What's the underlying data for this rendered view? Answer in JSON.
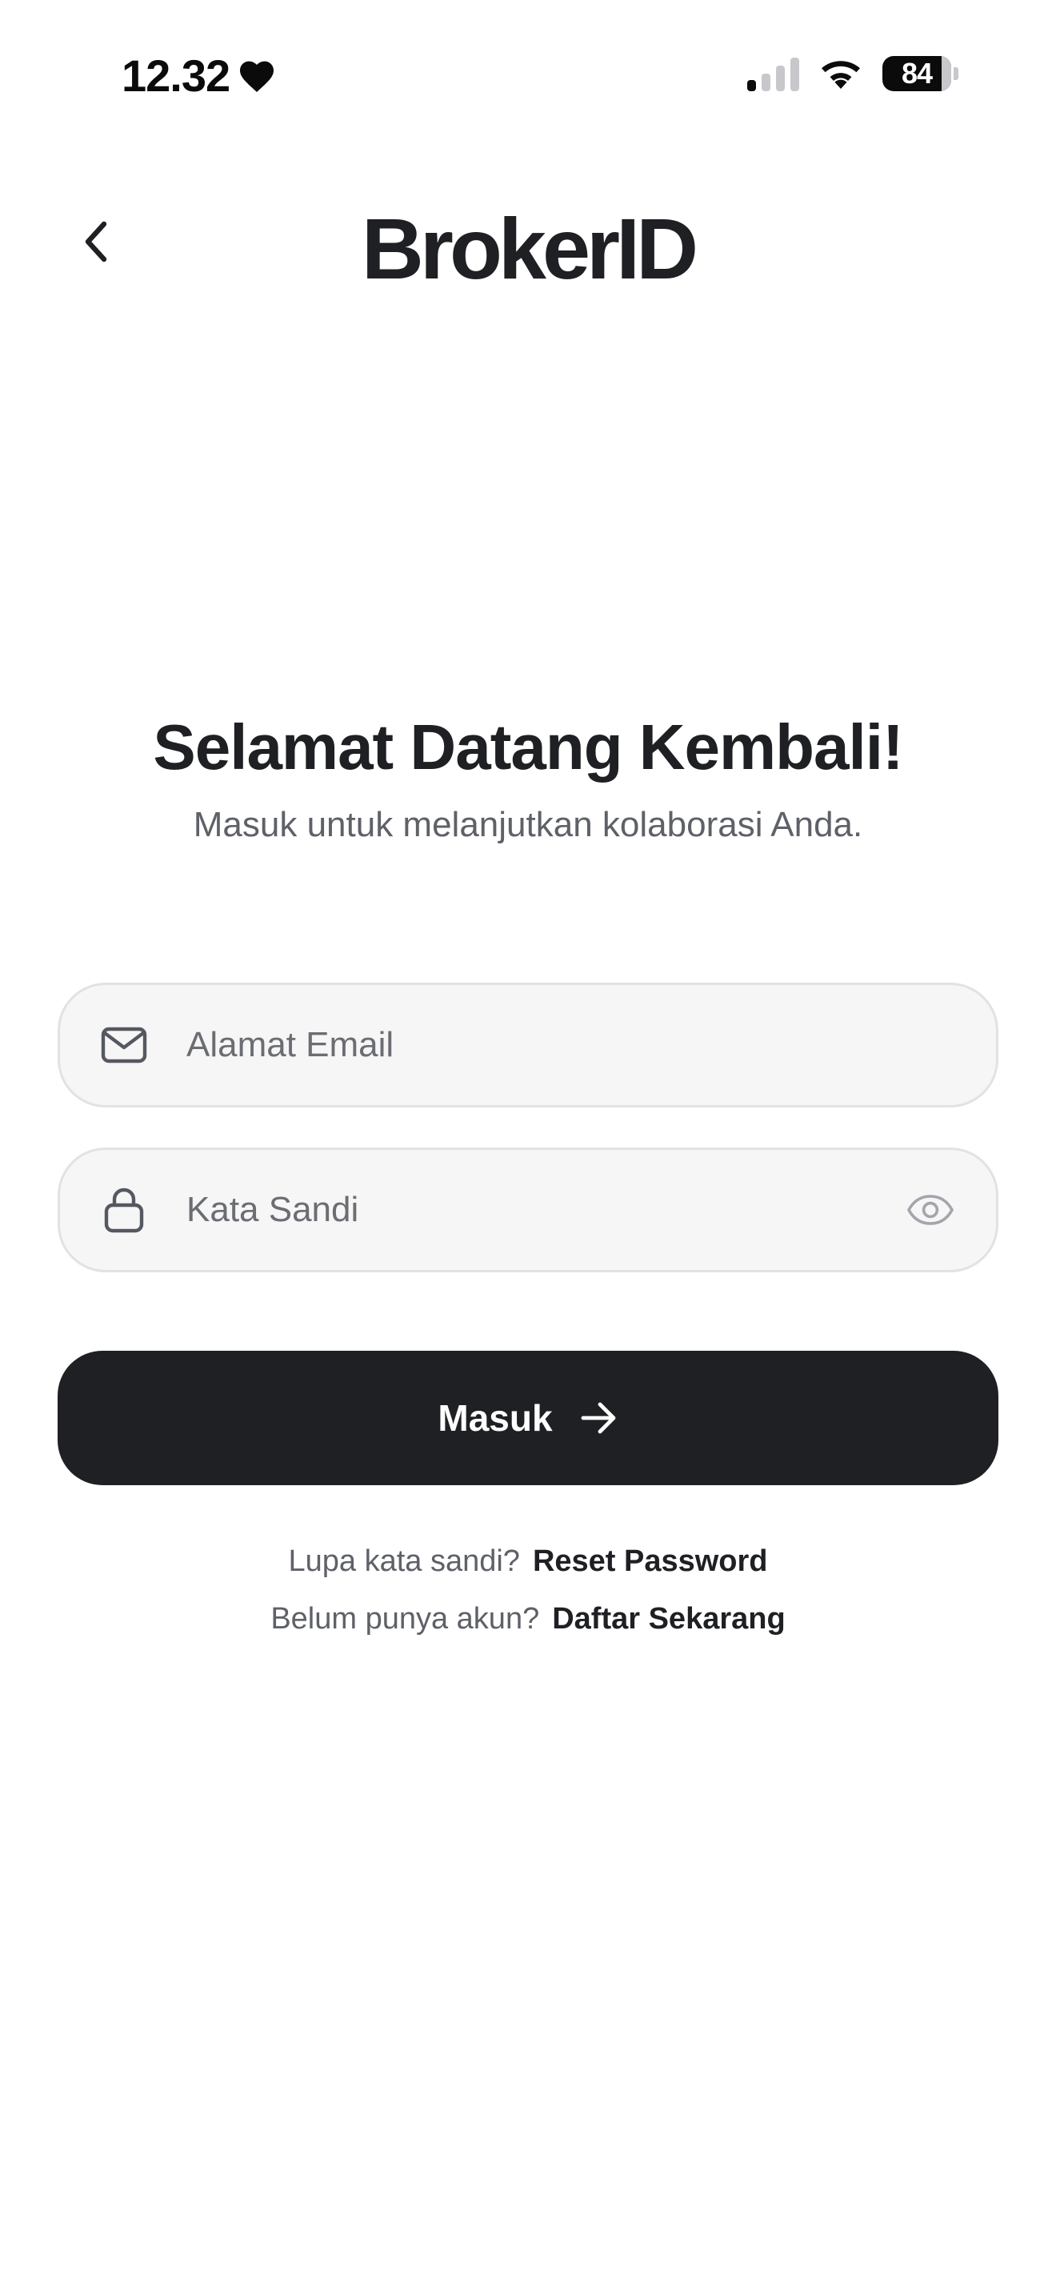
{
  "status_bar": {
    "time": "12.32",
    "battery": "84",
    "icons": [
      "heart-icon",
      "signal-icon",
      "wifi-icon",
      "battery-icon"
    ]
  },
  "header": {
    "brand": "BrokerID",
    "back_icon": "chevron-left-icon"
  },
  "welcome": {
    "title": "Selamat Datang Kembali!",
    "subtitle": "Masuk untuk melanjutkan kolaborasi Anda."
  },
  "form": {
    "email": {
      "placeholder": "Alamat Email",
      "value": "",
      "icon": "mail-icon"
    },
    "password": {
      "placeholder": "Kata Sandi",
      "value": "",
      "icon": "lock-icon",
      "toggle_icon": "eye-icon"
    },
    "submit_label": "Masuk",
    "submit_icon": "arrow-right-icon"
  },
  "links": {
    "forgot_prompt": "Lupa kata sandi?",
    "forgot_link": "Reset Password",
    "signup_prompt": "Belum punya akun?",
    "signup_link": "Daftar Sekarang"
  },
  "colors": {
    "primary": "#1f2024",
    "field_bg": "#f6f6f7",
    "field_border": "#e2e2e5",
    "muted_text": "#5f6168"
  }
}
